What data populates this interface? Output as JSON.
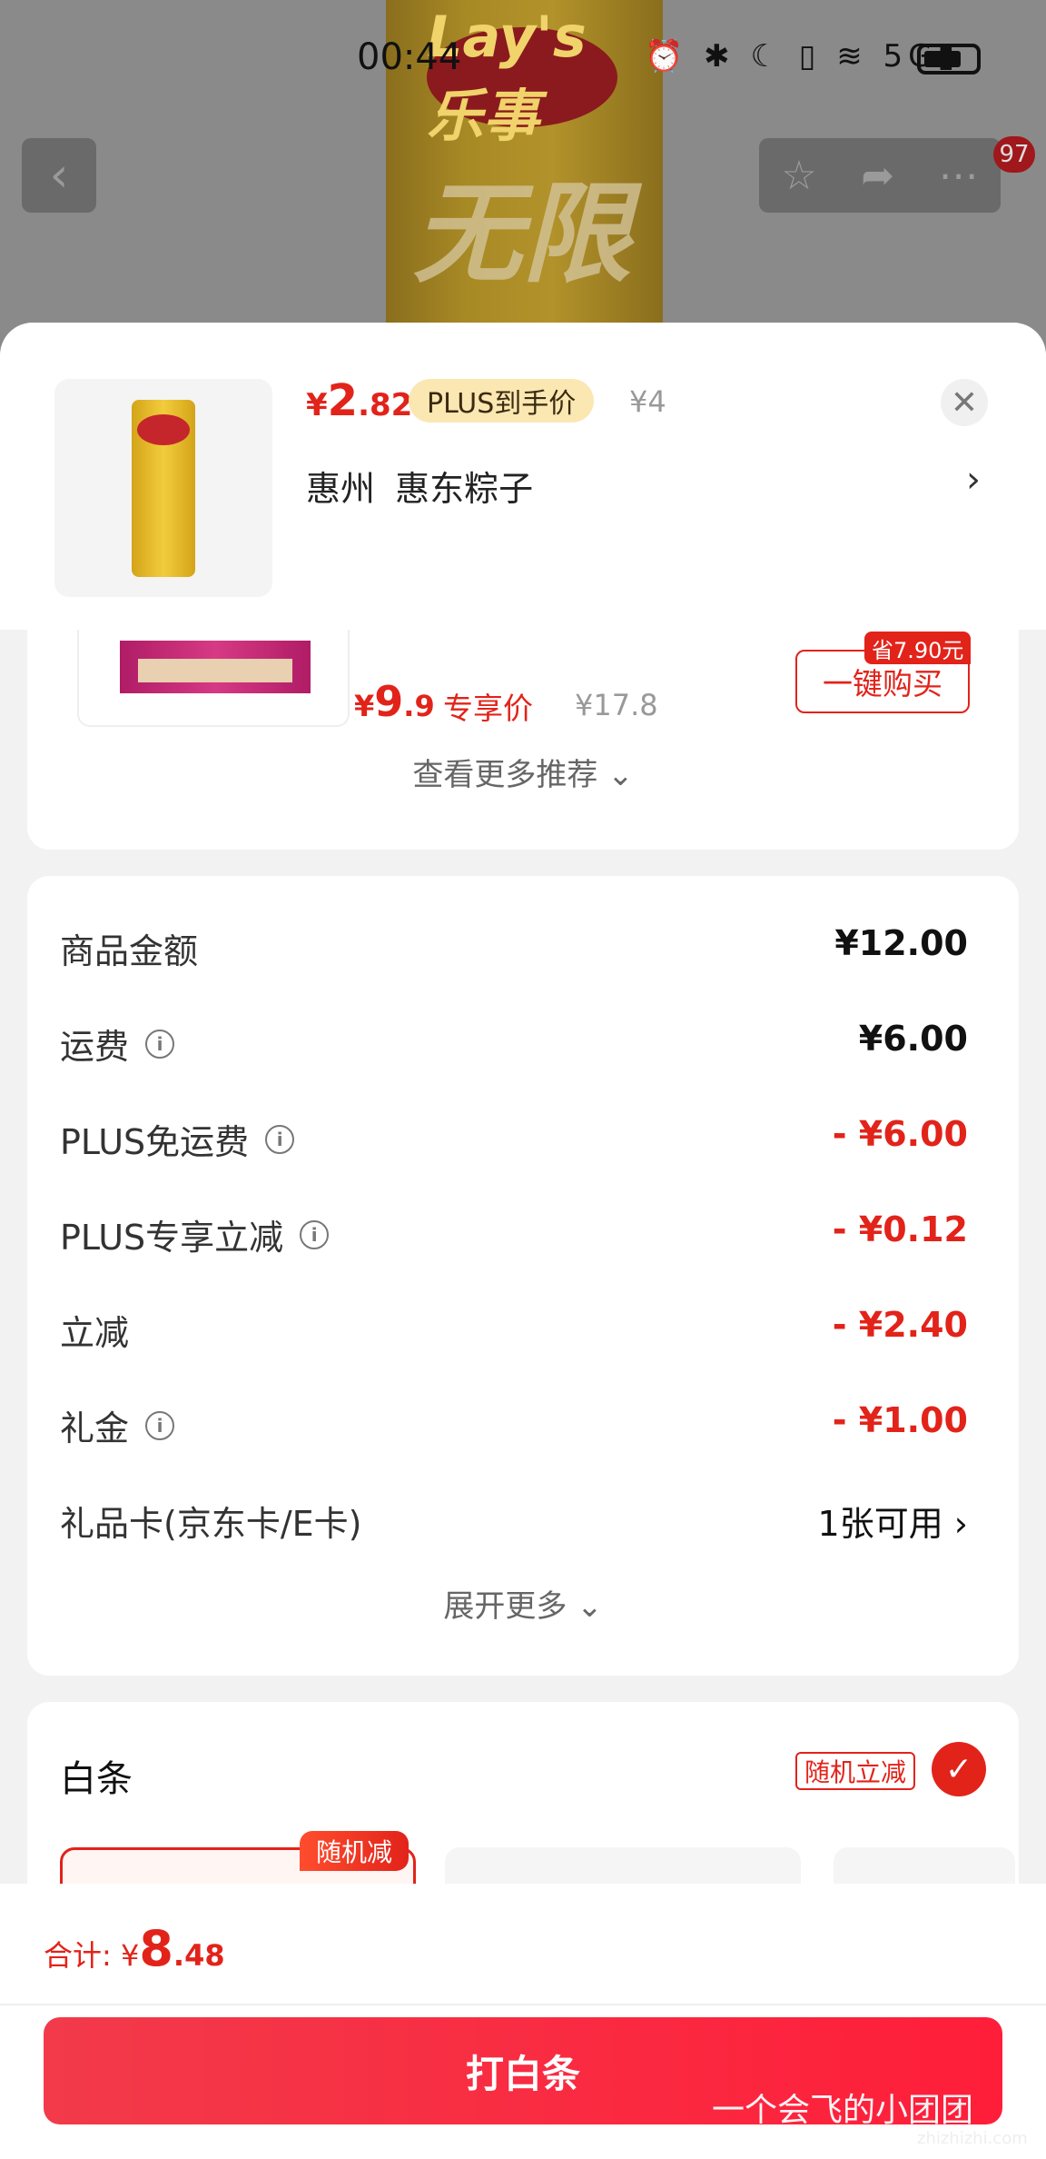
{
  "status_bar": {
    "time": "00:44",
    "icons": "⏰ ✱ ☾ ▯ ≋ 5G▮"
  },
  "background_page": {
    "logo_text": "Lay's乐事",
    "product_text": "无限",
    "cart_badge": "97",
    "back_icon": "chevron-left-icon",
    "actions": [
      "star-icon",
      "share-icon",
      "more-icon"
    ]
  },
  "product": {
    "price_currency": "¥",
    "price_integer": "2",
    "price_decimal": ".82",
    "plus_tag": "PLUS到手价",
    "original_price": "¥4",
    "address": "惠州 惠东粽子"
  },
  "recommendation": {
    "price_currency": "¥",
    "price_integer": "9",
    "price_decimal": ".9",
    "label": "专享价",
    "original_price": "¥17.8",
    "save_tag": "省7.90元",
    "buy_button": "一键购买",
    "see_more": "查看更多推荐"
  },
  "summary": {
    "rows": [
      {
        "label": "商品金额",
        "value": "¥12.00",
        "info": false,
        "style": "normal"
      },
      {
        "label": "运费",
        "value": "¥6.00",
        "info": true,
        "style": "normal"
      },
      {
        "label": "PLUS免运费",
        "value": "- ¥6.00",
        "info": true,
        "style": "red"
      },
      {
        "label": "PLUS专享立减",
        "value": "- ¥0.12",
        "info": true,
        "style": "red"
      },
      {
        "label": "立减",
        "value": "- ¥2.40",
        "info": false,
        "style": "red"
      },
      {
        "label": "礼金",
        "value": "- ¥1.00",
        "info": true,
        "style": "red"
      },
      {
        "label": "礼品卡(京东卡/E卡)",
        "value": "1张可用 ›",
        "info": false,
        "style": "plain"
      }
    ],
    "expand_more": "展开更多"
  },
  "baitiao": {
    "title": "白条",
    "random_tag": "随机立减",
    "plan_tag": "随机减"
  },
  "footer": {
    "total_label": "合计: ",
    "total_currency": "¥",
    "total_integer": "8",
    "total_decimal": ".48",
    "pay_button": "打白条",
    "watermark": "一个会飞的小团团",
    "watermark_url": "zhizhizhi.com"
  },
  "colors": {
    "accent": "#e2231a",
    "plus_tag_bg": "#fbe7b2",
    "pay_button": "#ff1e3a"
  }
}
